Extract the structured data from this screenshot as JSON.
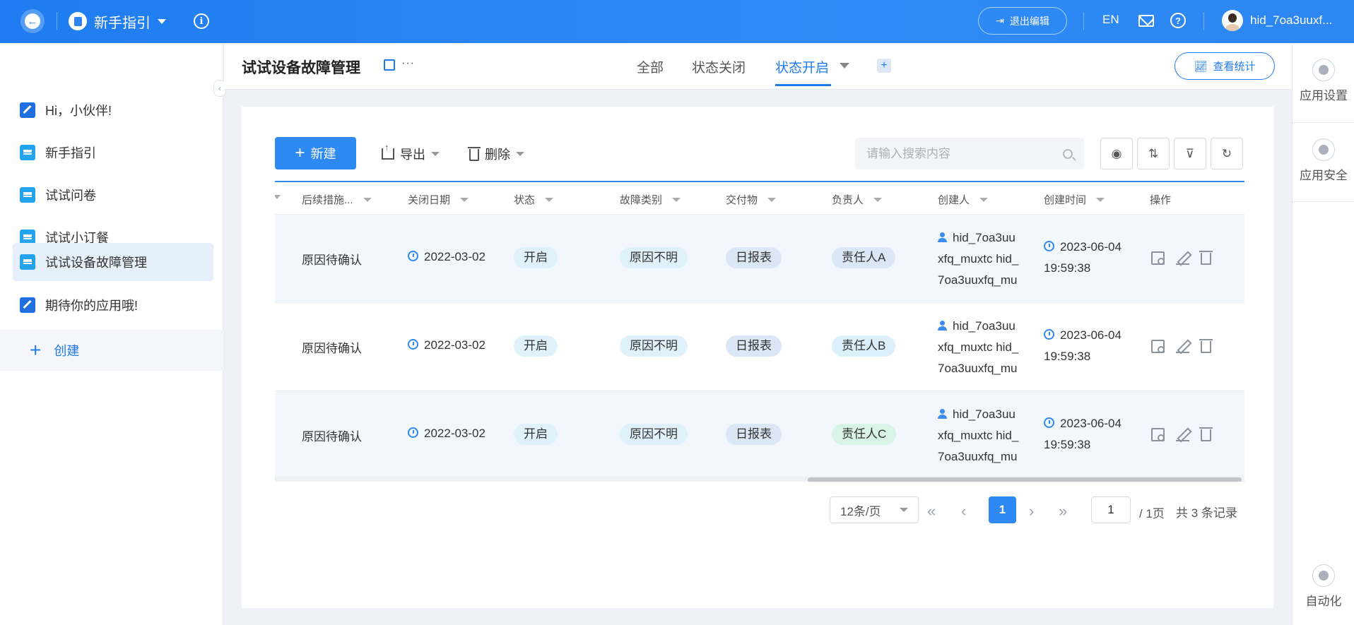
{
  "topbar": {
    "app_name": "新手指引",
    "exit_edit": "退出编辑",
    "lang": "EN",
    "user_name": "hid_7oa3uuxf..."
  },
  "sidebar": {
    "items": [
      {
        "label": "Hi，小伙伴!",
        "icon": "edit-icon"
      },
      {
        "label": "新手指引",
        "icon": "doc-icon"
      },
      {
        "label": "试试问卷",
        "icon": "doc-icon"
      },
      {
        "label": "试试小订餐",
        "icon": "doc-icon"
      },
      {
        "label": "试试设备故障管理",
        "icon": "doc-icon",
        "active": true
      },
      {
        "label": "期待你的应用哦!",
        "icon": "edit-icon"
      }
    ],
    "create_label": "创建"
  },
  "header": {
    "title": "试试设备故障管理",
    "tabs": [
      {
        "label": "全部"
      },
      {
        "label": "状态关闭"
      },
      {
        "label": "状态开启",
        "active": true
      }
    ],
    "stats_button": "查看统计"
  },
  "rail": {
    "app_settings": "应用设置",
    "app_security": "应用安全",
    "automation": "自动化"
  },
  "toolbar": {
    "new_label": "新建",
    "export_label": "导出",
    "delete_label": "删除",
    "search_placeholder": "请输入搜索内容"
  },
  "table": {
    "columns": [
      "后续措施...",
      "关闭日期",
      "状态",
      "故障类别",
      "交付物",
      "负责人",
      "创建人",
      "创建时间",
      "操作"
    ],
    "rows": [
      {
        "measure": "原因待确认",
        "close_date": "2022-03-02",
        "status": "开启",
        "category": "原因不明",
        "deliverable": "日报表",
        "owner": "责任人A",
        "creator": "hid_7oa3uuxfq_muxtc hid_7oa3uuxfq_mu",
        "created_date": "2023-06-04",
        "created_time": "19:59:38"
      },
      {
        "measure": "原因待确认",
        "close_date": "2022-03-02",
        "status": "开启",
        "category": "原因不明",
        "deliverable": "日报表",
        "owner": "责任人B",
        "creator": "hid_7oa3uuxfq_muxtc hid_7oa3uuxfq_mu",
        "created_date": "2023-06-04",
        "created_time": "19:59:38"
      },
      {
        "measure": "原因待确认",
        "close_date": "2022-03-02",
        "status": "开启",
        "category": "原因不明",
        "deliverable": "日报表",
        "owner": "责任人C",
        "creator": "hid_7oa3uuxfq_muxtc hid_7oa3uuxfq_mu",
        "created_date": "2023-06-04",
        "created_time": "19:59:38"
      }
    ]
  },
  "pagination": {
    "page_size": "12条/页",
    "current_page": "1",
    "page_input": "1",
    "total_pages": "/ 1页",
    "total_records": "共 3 条记录"
  }
}
